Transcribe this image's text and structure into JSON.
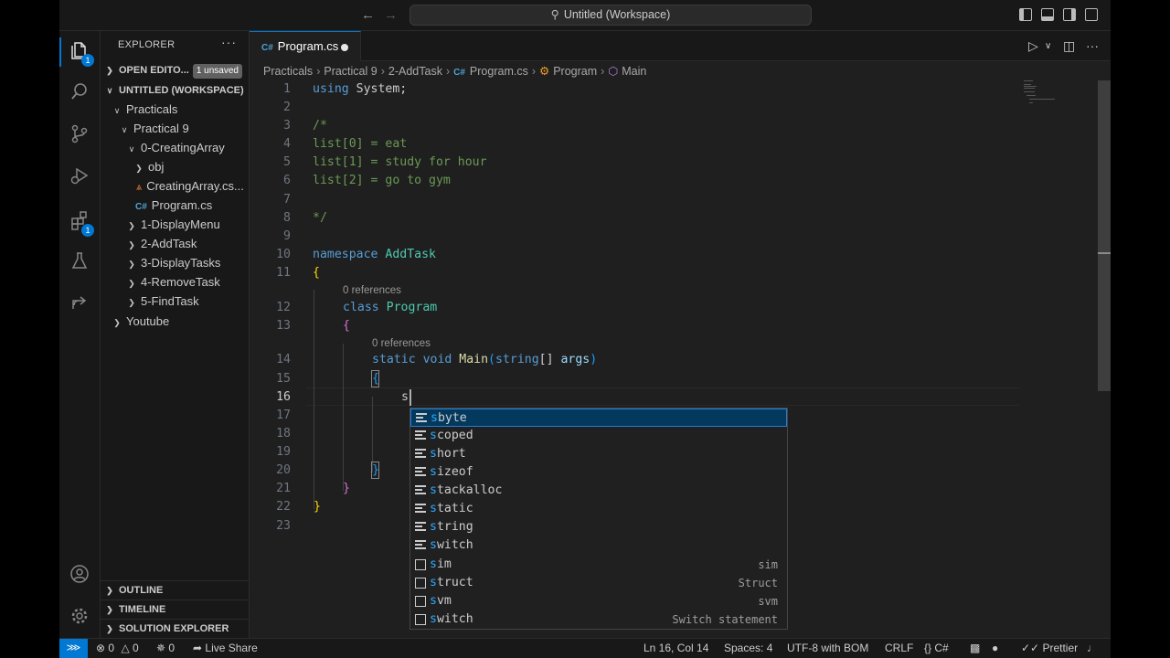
{
  "window": {
    "title": "Untitled (Workspace)"
  },
  "activity": {
    "explorer_badge": "1",
    "extensions_badge": "1"
  },
  "sidebar": {
    "title": "EXPLORER",
    "more": "···",
    "open_editors": "OPEN EDITO...",
    "unsaved_badge": "1 unsaved",
    "workspace": "UNTITLED (WORKSPACE)",
    "tree": [
      {
        "label": "Practicals"
      },
      {
        "label": "Practical 9"
      },
      {
        "label": "0-CreatingArray"
      },
      {
        "label": "obj"
      },
      {
        "label": "CreatingArray.cs..."
      },
      {
        "label": "Program.cs"
      },
      {
        "label": "1-DisplayMenu"
      },
      {
        "label": "2-AddTask"
      },
      {
        "label": "3-DisplayTasks"
      },
      {
        "label": "4-RemoveTask"
      },
      {
        "label": "5-FindTask"
      },
      {
        "label": "Youtube"
      }
    ],
    "panels": {
      "outline": "OUTLINE",
      "timeline": "TIMELINE",
      "solution": "SOLUTION EXPLORER"
    }
  },
  "editor": {
    "tab_label": "Program.cs",
    "breadcrumbs": [
      "Practicals",
      "Practical 9",
      "2-AddTask",
      "Program.cs",
      "Program",
      "Main"
    ],
    "lines": [
      {
        "n": "1"
      },
      {
        "n": "2"
      },
      {
        "n": "3"
      },
      {
        "n": "4"
      },
      {
        "n": "5"
      },
      {
        "n": "6"
      },
      {
        "n": "7"
      },
      {
        "n": "8"
      },
      {
        "n": "9"
      },
      {
        "n": "10"
      },
      {
        "n": "11"
      },
      {
        "n": "12"
      },
      {
        "n": "13"
      },
      {
        "n": "14"
      },
      {
        "n": "15"
      },
      {
        "n": "16"
      },
      {
        "n": "17"
      },
      {
        "n": "18"
      },
      {
        "n": "19"
      },
      {
        "n": "20"
      },
      {
        "n": "21"
      },
      {
        "n": "22"
      },
      {
        "n": "23"
      }
    ],
    "code": {
      "l1_kw": "using",
      "l1_rest": " System;",
      "l3": "/*",
      "l4": "list[0] = eat",
      "l5": "list[1] = study for hour",
      "l6": "list[2] = go to gym",
      "l8": "*/",
      "l10_kw": "namespace",
      "l10_name": " AddTask",
      "l11": "{",
      "l12_kw": "class",
      "l12_name": " Program",
      "l13": "{",
      "l14_kw1": "static",
      "l14_kw2": " void",
      "l14_fn": " Main",
      "l14_p1": "(",
      "l14_kw3": "string",
      "l14_arr": "[]",
      "l14_arg": " args",
      "l14_p2": ")",
      "l15": "{",
      "l16": "s",
      "l20": "}",
      "l21": "}",
      "l22": "}"
    },
    "codelens_class": "0 references",
    "codelens_method": "0 references"
  },
  "suggest": {
    "items": [
      {
        "match": "s",
        "rest": "byte",
        "detail": "",
        "kind": "keyword"
      },
      {
        "match": "s",
        "rest": "coped",
        "detail": "",
        "kind": "keyword"
      },
      {
        "match": "s",
        "rest": "hort",
        "detail": "",
        "kind": "keyword"
      },
      {
        "match": "s",
        "rest": "izeof",
        "detail": "",
        "kind": "keyword"
      },
      {
        "match": "s",
        "rest": "tackalloc",
        "detail": "",
        "kind": "keyword"
      },
      {
        "match": "s",
        "rest": "tatic",
        "detail": "",
        "kind": "keyword"
      },
      {
        "match": "s",
        "rest": "tring",
        "detail": "",
        "kind": "keyword"
      },
      {
        "match": "s",
        "rest": "witch",
        "detail": "",
        "kind": "keyword"
      },
      {
        "match": "s",
        "rest": "im",
        "detail": "sim",
        "kind": "snippet"
      },
      {
        "match": "s",
        "rest": "truct",
        "detail": "Struct",
        "kind": "snippet"
      },
      {
        "match": "s",
        "rest": "vm",
        "detail": "svm",
        "kind": "snippet"
      },
      {
        "match": "s",
        "rest": "witch",
        "detail": "Switch statement",
        "kind": "snippet"
      }
    ]
  },
  "status": {
    "errors": "0",
    "warnings": "0",
    "ports": "0",
    "live_share": "Live Share",
    "position": "Ln 16, Col 14",
    "spaces": "Spaces: 4",
    "encoding": "UTF-8 with BOM",
    "eol": "CRLF",
    "language": "C#",
    "prettier": "Prettier"
  },
  "colors": {
    "accent": "#0078d4",
    "selection": "#04395e"
  }
}
